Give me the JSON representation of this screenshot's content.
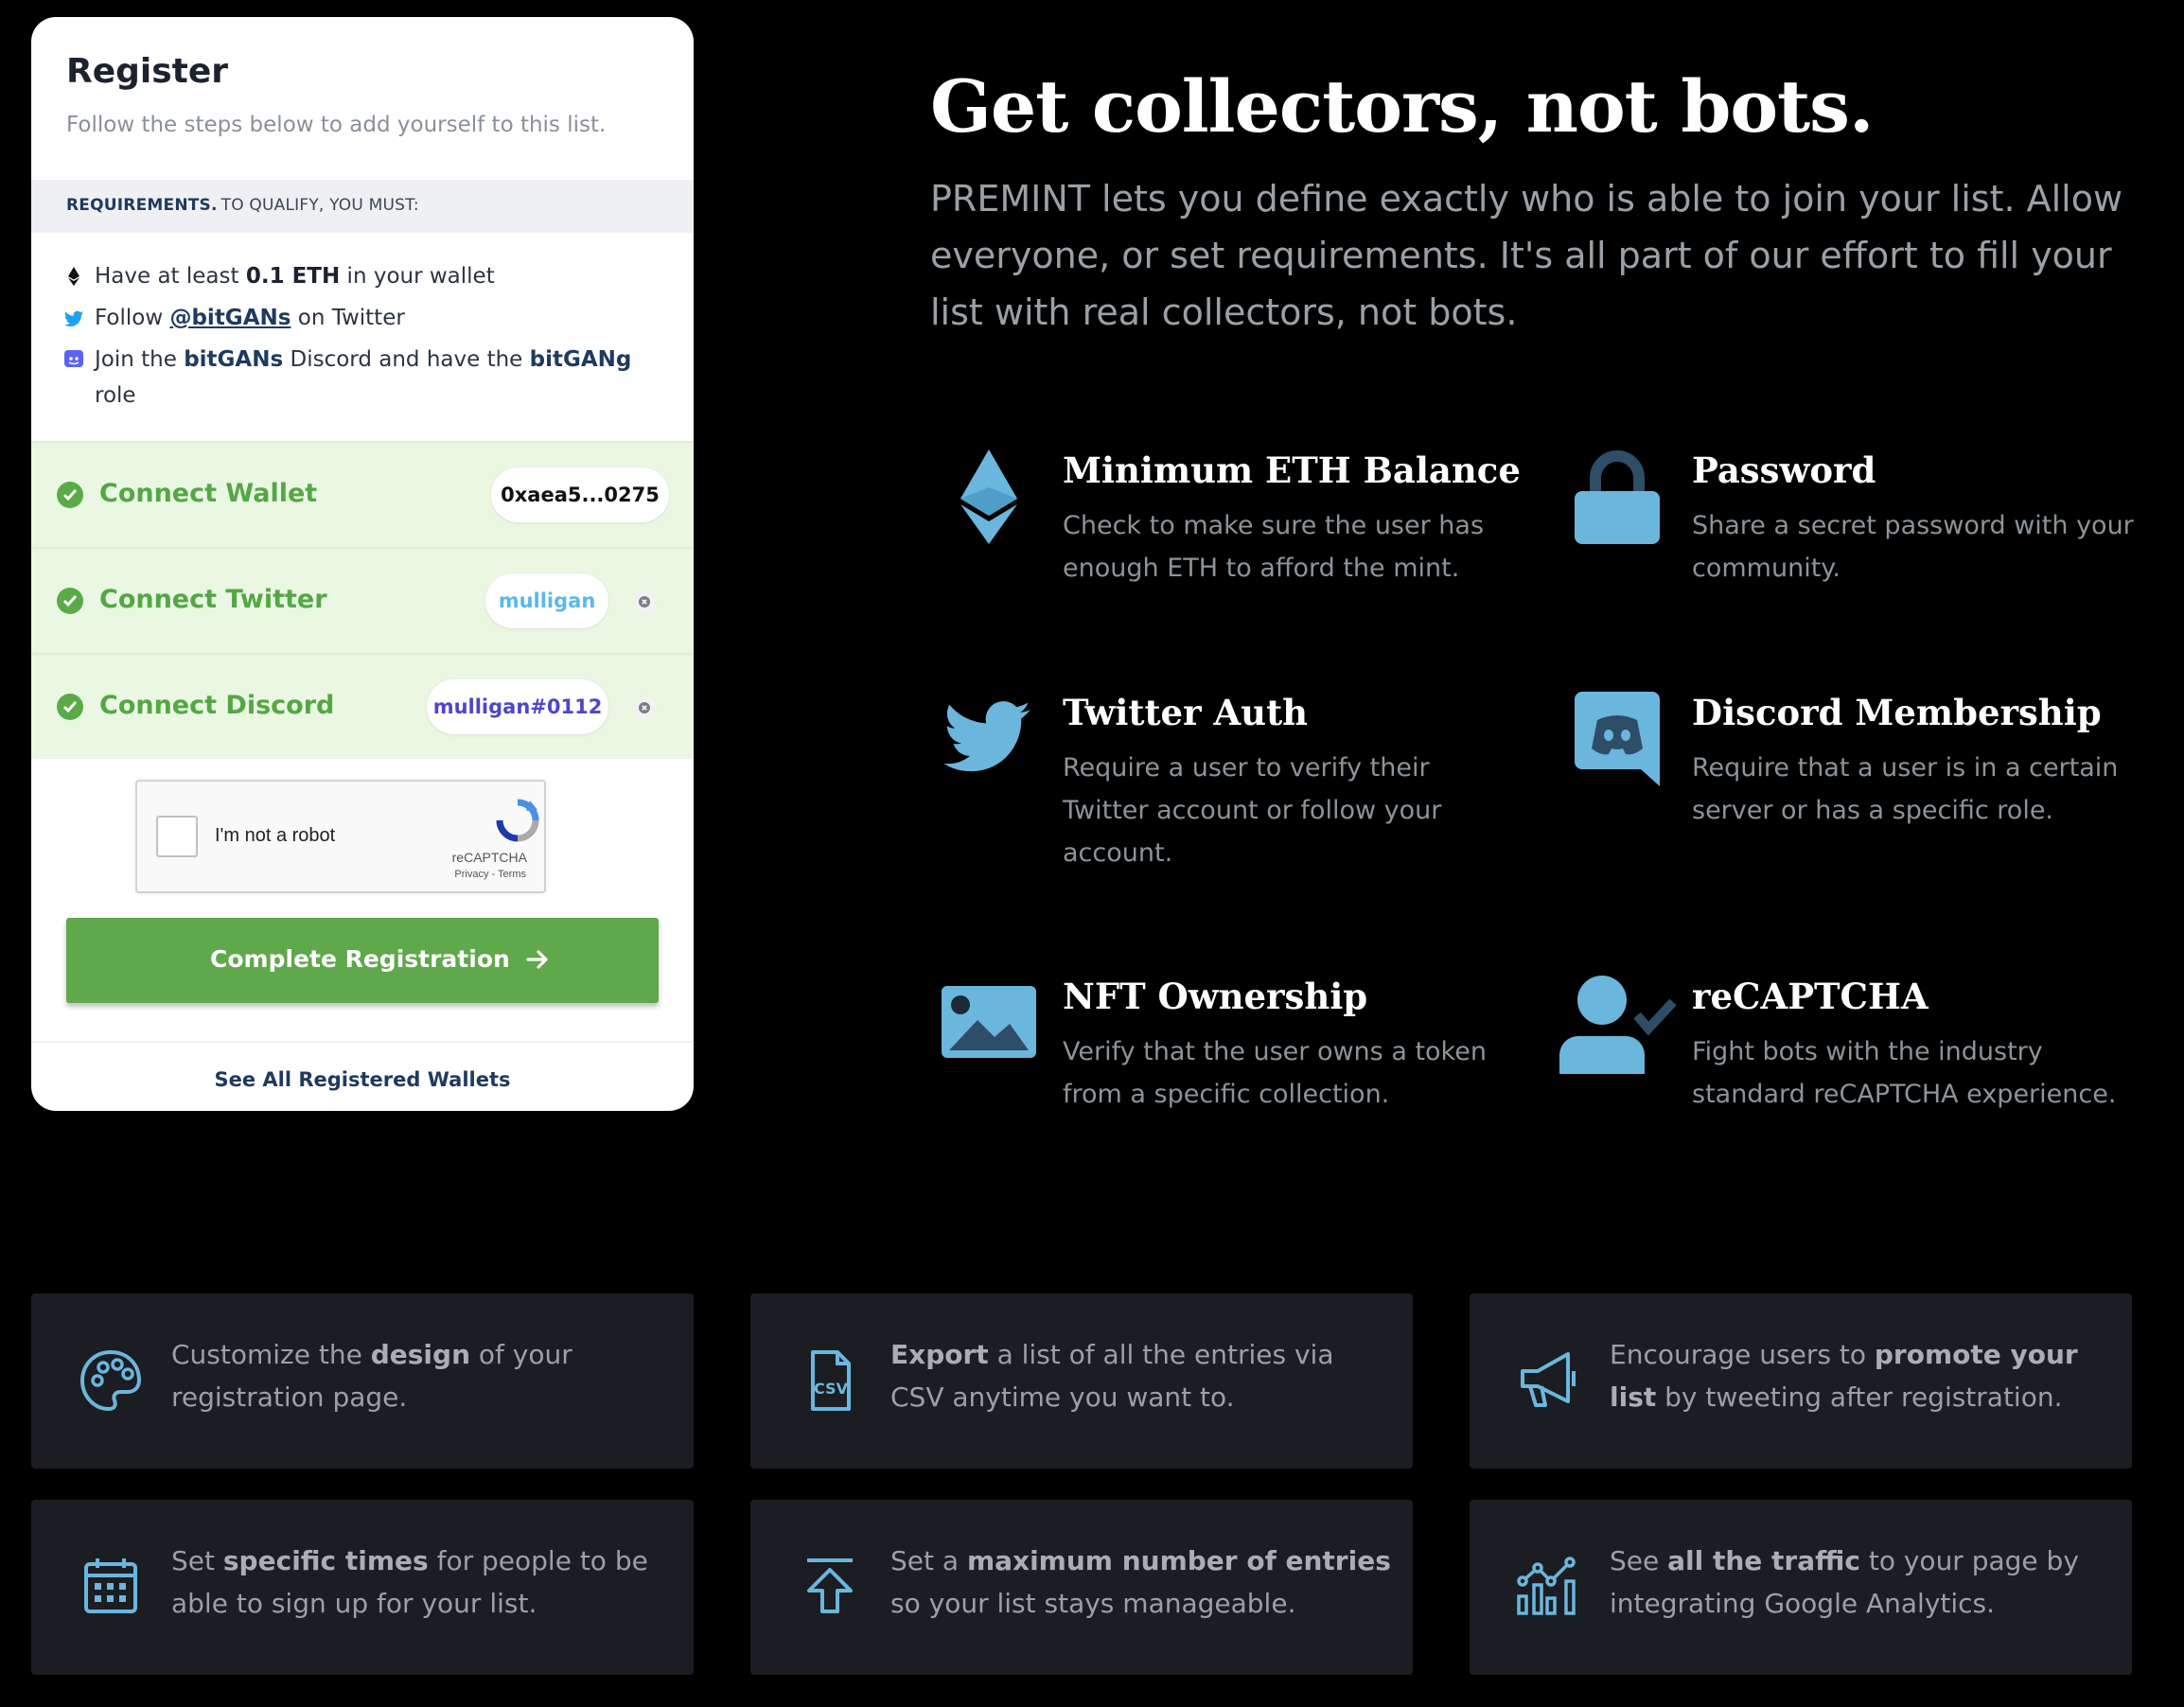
{
  "register": {
    "title": "Register",
    "subtitle": "Follow the steps below to add yourself to this list.",
    "requirements_label": "REQUIREMENTS.",
    "requirements_sub": "TO QUALIFY, YOU MUST:",
    "req_eth": {
      "pre": "Have at least ",
      "bold": "0.1 ETH",
      "post": " in your wallet"
    },
    "req_twitter": {
      "pre": "Follow ",
      "handle": "@bitGANs",
      "post": " on Twitter"
    },
    "req_discord": {
      "pre": "Join the ",
      "server": "bitGANs",
      "mid": " Discord and have the ",
      "role": "bitGANg",
      "post": " role"
    },
    "steps": {
      "wallet": {
        "label": "Connect Wallet",
        "value": "0xaea5...0275"
      },
      "twitter": {
        "label": "Connect Twitter",
        "value": "mulligan"
      },
      "discord": {
        "label": "Connect Discord",
        "value": "mulligan#0112"
      }
    },
    "captcha": {
      "label": "I'm not a robot",
      "brand": "reCAPTCHA",
      "links": "Privacy - Terms"
    },
    "submit_label": "Complete Registration",
    "footer_link": "See All Registered Wallets"
  },
  "hero": {
    "title": "Get collectors, not bots.",
    "description": "PREMINT lets you define exactly who is able to join your list. Allow everyone, or set requirements. It's all part of our effort to fill your list with real collectors, not bots."
  },
  "features": [
    {
      "icon": "ethereum-icon",
      "title": "Minimum ETH Balance",
      "desc": "Check to make sure the user has enough ETH to afford the mint."
    },
    {
      "icon": "lock-icon",
      "title": "Password",
      "desc": "Share a secret password with your community."
    },
    {
      "icon": "twitter-icon",
      "title": "Twitter Auth",
      "desc": "Require a user to verify their Twitter account or follow your account."
    },
    {
      "icon": "discord-icon",
      "title": "Discord Membership",
      "desc": "Require that a user is in a certain server or has a specific role."
    },
    {
      "icon": "image-icon",
      "title": "NFT Ownership",
      "desc": "Verify that the user owns a token from a specific collection."
    },
    {
      "icon": "user-check-icon",
      "title": "reCAPTCHA",
      "desc": "Fight bots with the industry standard reCAPTCHA experience."
    }
  ],
  "tiles": [
    {
      "icon": "palette-icon",
      "pre": "Customize the ",
      "bold": "design",
      "post": " of your registration page."
    },
    {
      "icon": "csv-file-icon",
      "pre": "",
      "bold": "Export",
      "post": " a list of all the entries via CSV anytime you want to."
    },
    {
      "icon": "megaphone-icon",
      "pre": "Encourage users to ",
      "bold": "promote your list",
      "post": " by tweeting after registration."
    },
    {
      "icon": "calendar-icon",
      "pre": "Set ",
      "bold": "specific times",
      "post": " for people to be able to sign up for your list."
    },
    {
      "icon": "upload-arrow-icon",
      "pre": "Set a ",
      "bold": "maximum number of entries",
      "post": " so your list stays manageable."
    },
    {
      "icon": "analytics-icon",
      "pre": "See ",
      "bold": "all the traffic",
      "post": " to your page by integrating Google Analytics."
    }
  ],
  "colors": {
    "accent_green": "#5fa84c",
    "icon_blue": "#6bb6dd",
    "navy": "#1e3a5f",
    "tile_bg": "#1b1d22"
  }
}
